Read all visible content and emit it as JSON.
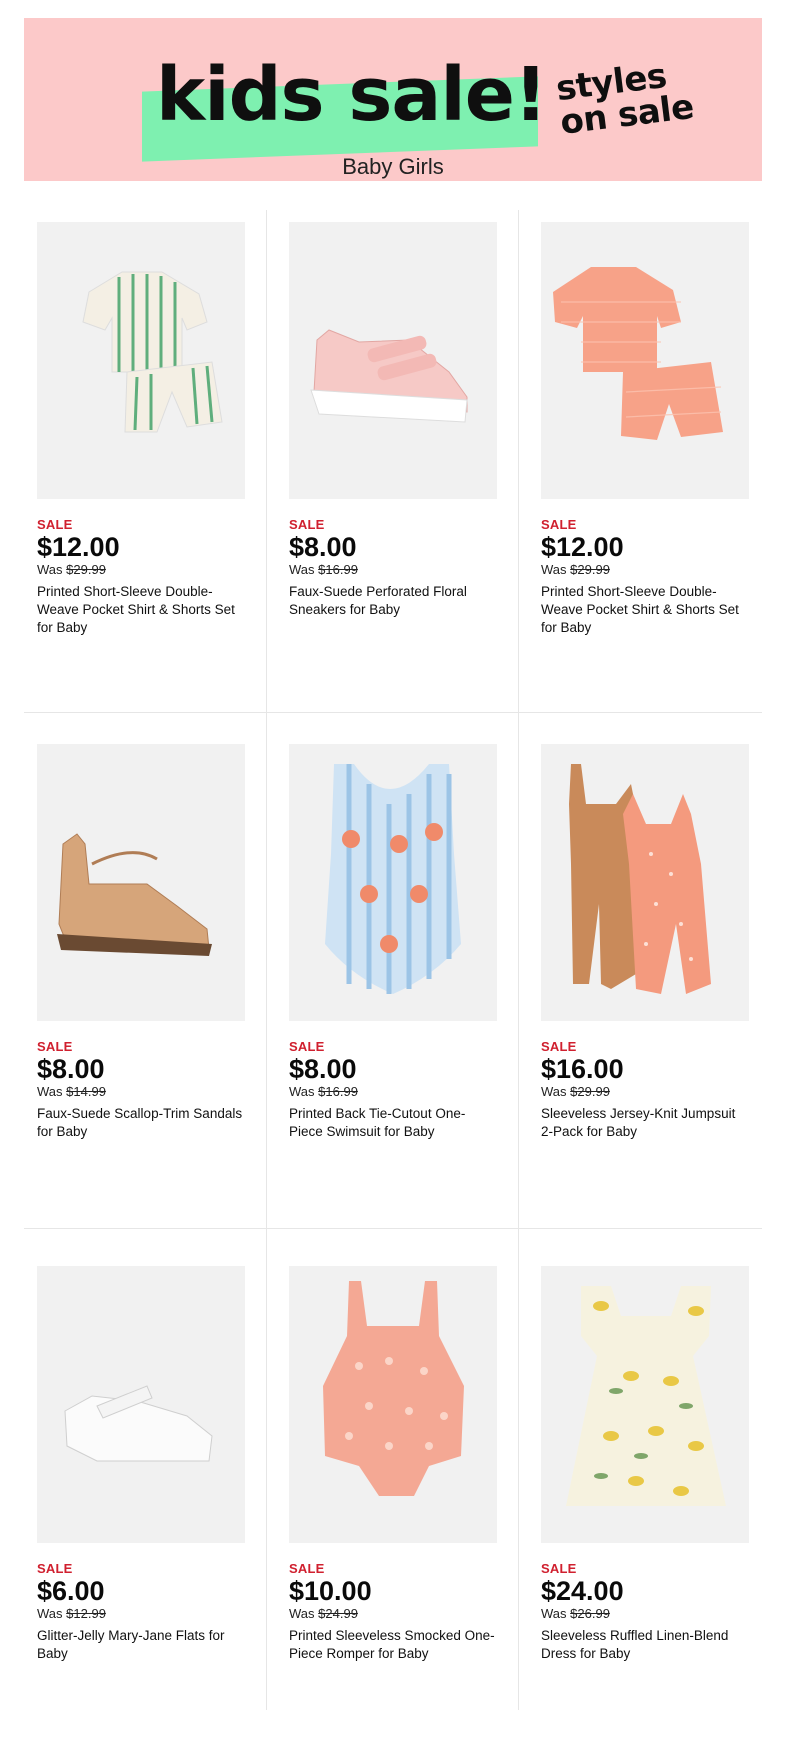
{
  "banner": {
    "headline": "kids sale!",
    "tagline_line1": "styles",
    "tagline_line2": "on sale",
    "category": "Baby Girls",
    "colors": {
      "background": "#fcc9c9",
      "highlight": "#7ef0b0"
    }
  },
  "sale_color": "#d0202f",
  "products": [
    {
      "badge": "SALE",
      "price": "$12.00",
      "was_label": "Was",
      "was_price": "$29.99",
      "name": "Printed Short-Sleeve Double-Weave Pocket Shirt & Shorts Set for Baby",
      "image_icon": "striped-shirt-shorts-set-icon"
    },
    {
      "badge": "SALE",
      "price": "$8.00",
      "was_label": "Was",
      "was_price": "$16.99",
      "name": "Faux-Suede Perforated Floral Sneakers for Baby",
      "image_icon": "pink-sneaker-icon"
    },
    {
      "badge": "SALE",
      "price": "$12.00",
      "was_label": "Was",
      "was_price": "$29.99",
      "name": "Printed Short-Sleeve Double-Weave Pocket Shirt & Shorts Set for Baby",
      "image_icon": "gingham-shirt-shorts-set-icon"
    },
    {
      "badge": "SALE",
      "price": "$8.00",
      "was_label": "Was",
      "was_price": "$14.99",
      "name": "Faux-Suede Scallop-Trim Sandals for Baby",
      "image_icon": "tan-sandal-icon"
    },
    {
      "badge": "SALE",
      "price": "$8.00",
      "was_label": "Was",
      "was_price": "$16.99",
      "name": "Printed Back Tie-Cutout One-Piece Swimsuit for Baby",
      "image_icon": "peach-print-swimsuit-icon"
    },
    {
      "badge": "SALE",
      "price": "$16.00",
      "was_label": "Was",
      "was_price": "$29.99",
      "name": "Sleeveless Jersey-Knit Jumpsuit 2-Pack for Baby",
      "image_icon": "jumpsuit-2-pack-icon"
    },
    {
      "badge": "SALE",
      "price": "$6.00",
      "was_label": "Was",
      "was_price": "$12.99",
      "name": "Glitter-Jelly Mary-Jane Flats for Baby",
      "image_icon": "jelly-flat-shoe-icon"
    },
    {
      "badge": "SALE",
      "price": "$10.00",
      "was_label": "Was",
      "was_price": "$24.99",
      "name": "Printed Sleeveless Smocked One-Piece Romper for Baby",
      "image_icon": "smocked-romper-icon"
    },
    {
      "badge": "SALE",
      "price": "$24.00",
      "was_label": "Was",
      "was_price": "$26.99",
      "name": "Sleeveless Ruffled Linen-Blend Dress for Baby",
      "image_icon": "lemon-print-dress-icon"
    }
  ]
}
